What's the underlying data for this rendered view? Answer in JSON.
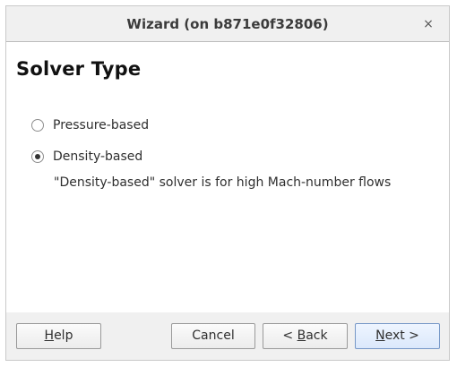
{
  "window": {
    "title": "Wizard (on b871e0f32806)",
    "close_symbol": "×"
  },
  "page": {
    "title": "Solver Type",
    "options": [
      {
        "label": "Pressure-based",
        "selected": false
      },
      {
        "label": "Density-based",
        "selected": true
      }
    ],
    "description": "\"Density-based\" solver is for high Mach-number flows"
  },
  "footer": {
    "help": {
      "mnemonic": "H",
      "rest": "elp"
    },
    "cancel": "Cancel",
    "back": {
      "prefix": "< ",
      "mnemonic": "B",
      "rest": "ack"
    },
    "next": {
      "mnemonic": "N",
      "rest": "ext >"
    }
  },
  "colors": {
    "titlebar": "#f0f0f0",
    "footer": "#f0f0f0",
    "default_button_border": "#7798c7"
  },
  "icons": {
    "close": "close-icon",
    "radio_unchecked": "radio-unchecked-icon",
    "radio_checked": "radio-checked-icon"
  }
}
